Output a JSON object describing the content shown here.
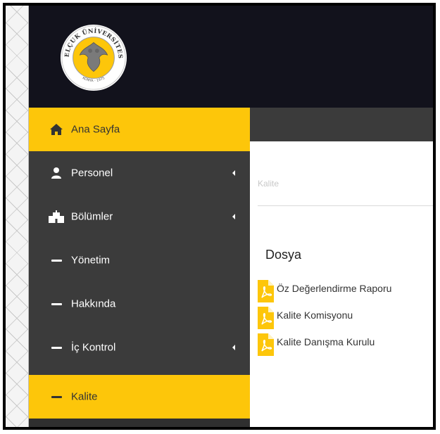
{
  "header": {
    "logo_text": "SELÇUK ÜNİVERSİTESİ",
    "logo_subtext": "KONYA 1975"
  },
  "sidebar": {
    "items": [
      {
        "label": "Ana Sayfa",
        "icon": "home-icon",
        "active": true,
        "has_submenu": false
      },
      {
        "label": "Personel",
        "icon": "user-icon",
        "active": false,
        "has_submenu": true
      },
      {
        "label": "Bölümler",
        "icon": "building-icon",
        "active": false,
        "has_submenu": true
      },
      {
        "label": "Yönetim",
        "icon": "dash-icon",
        "active": false,
        "has_submenu": false
      },
      {
        "label": "Hakkında",
        "icon": "dash-icon",
        "active": false,
        "has_submenu": false
      },
      {
        "label": "İç Kontrol",
        "icon": "dash-icon",
        "active": false,
        "has_submenu": true
      },
      {
        "label": "Kalite",
        "icon": "dash-icon",
        "active": true,
        "has_submenu": false
      }
    ]
  },
  "main": {
    "breadcrumb": "Kalite",
    "section_title": "Dosya",
    "files": [
      {
        "label": "Öz Değerlendirme Raporu",
        "icon": "pdf-icon"
      },
      {
        "label": "Kalite Komisyonu",
        "icon": "pdf-icon"
      },
      {
        "label": "Kalite Danışma Kurulu",
        "icon": "pdf-icon"
      }
    ]
  },
  "colors": {
    "accent": "#fdc60a",
    "sidebar": "#3b3b3b",
    "header": "#12121c"
  }
}
